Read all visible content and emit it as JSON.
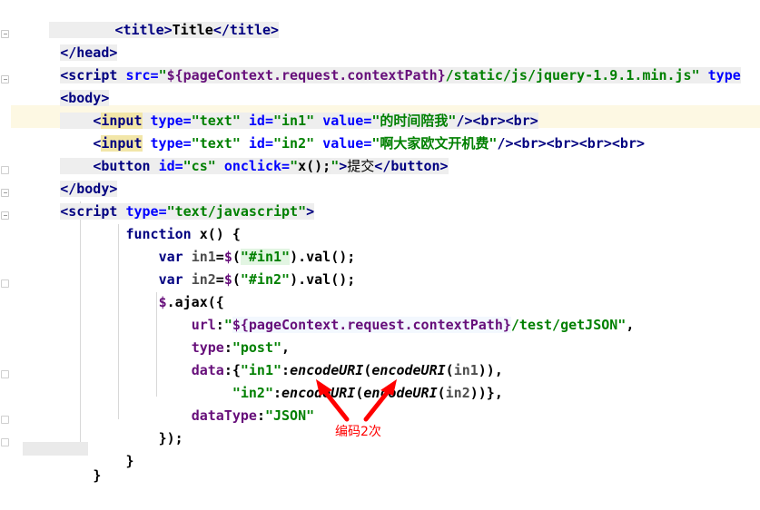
{
  "editor": {
    "language": "JSP / HTML",
    "font_size_px": 15,
    "line_height_px": 25,
    "background": "#ffffff"
  },
  "colors": {
    "tag": "#000080",
    "attribute": "#0000ff",
    "string": "#008000",
    "keyword": "#000080",
    "property": "#660e7a",
    "annotation_red": "#ff0000",
    "row_highlight_cream": "#fdf8e3",
    "token_highlight_yellow": "#f2e6a8",
    "token_highlight_gray": "#eeeeee",
    "token_highlight_green": "#e2f5e2",
    "token_highlight_blue": "#f3f8fe"
  },
  "lines": [
    {
      "n": 1,
      "text": "        <title>Title</title>"
    },
    {
      "n": 2,
      "text": "</head>"
    },
    {
      "n": 3,
      "text": "<script src=\"${pageContext.request.contextPath}/static/js/jquery-1.9.1.min.js\" type="
    },
    {
      "n": 4,
      "text": "<body>"
    },
    {
      "n": 5,
      "text": "    <input type=\"text\" id=\"in1\" value=\"的时间陪我\"/><br><br>"
    },
    {
      "n": 6,
      "text": "    <input type=\"text\" id=\"in2\" value=\"啊大家欧文开机费\"/><br><br><br><br>"
    },
    {
      "n": 7,
      "text": "    <button id=\"cs\" onclick=\"x();\">提交</button>"
    },
    {
      "n": 8,
      "text": "</body>"
    },
    {
      "n": 9,
      "text": "<script type=\"text/javascript\">"
    },
    {
      "n": 10,
      "text": "        function x() {"
    },
    {
      "n": 11,
      "text": "            var in1=$(\"#in1\").val();"
    },
    {
      "n": 12,
      "text": "            var in2=$(\"#in2\").val();"
    },
    {
      "n": 13,
      "text": "            $.ajax({"
    },
    {
      "n": 14,
      "text": "                url:\"${pageContext.request.contextPath}/test/getJSON\","
    },
    {
      "n": 15,
      "text": "                type:\"post\","
    },
    {
      "n": 16,
      "text": "                data:{\"in1\":encodeURI(encodeURI(in1)),"
    },
    {
      "n": 17,
      "text": "                     \"in2\":encodeURI(encodeURI(in2))},"
    },
    {
      "n": 18,
      "text": "                dataType:\"JSON\""
    },
    {
      "n": 19,
      "text": "            });"
    },
    {
      "n": 20,
      "text": "        }"
    },
    {
      "n": 21,
      "text": "    }"
    }
  ],
  "tokens": {
    "l1": {
      "indent": "        ",
      "open_lt": "<",
      "title_open": "title",
      "gt1": ">",
      "content": "Title",
      "close": "</title>"
    },
    "l2": {
      "text": "</head>"
    },
    "l3": {
      "tag_open": "<script",
      "attr_src": "src",
      "eq": "=",
      "quote": "\"",
      "el": "${pageContext.request.contextPath}",
      "path": "/static/js/jquery-1.9.1.min.js\"",
      "attr_type": "type"
    },
    "l4": {
      "text": "<body>"
    },
    "l5": {
      "lt": "<",
      "tagname": "input",
      "attr_type": "type",
      "val_text": "\"text\"",
      "attr_id": "id",
      "val_id": "\"in1\"",
      "attr_value": "value",
      "q1": "\"",
      "cjk": "的时间陪我",
      "q2": "\"",
      "tail": "/><br><br>"
    },
    "l6": {
      "lt": "<",
      "tagname": "input",
      "attr_type": "type",
      "val_text": "\"text\"",
      "attr_id": "id",
      "val_id": "\"in2\"",
      "attr_value": "value",
      "q1": "\"",
      "cjk": "啊大家欧文开机费",
      "q2": "\"",
      "tail": "/><br><br><br><br>"
    },
    "l7": {
      "lt": "<",
      "tagname": "button",
      "attr_id": "id",
      "val_id": "\"cs\"",
      "attr_onclick": "onclick",
      "q1": "\"",
      "js": "x();",
      "q2": "\"",
      "gt": ">",
      "cjk": "提交",
      "close": "</button>"
    },
    "l8": {
      "text": "</body>"
    },
    "l9": {
      "tag_open": "<script",
      "attr_type": "type",
      "eq": "=",
      "val": "\"text/javascript\"",
      "gt": ">"
    },
    "l10": {
      "kw": "function",
      "name": "x()",
      "brace": "{"
    },
    "l11": {
      "kw": "var",
      "name": "in1",
      "eq": "=",
      "dollar": "$",
      "lp": "(",
      "sel": "\"#in1\"",
      "rest": ").val();"
    },
    "l12": {
      "kw": "var",
      "name": "in2",
      "eq": "=",
      "dollar": "$",
      "lp": "(",
      "sel": "\"#in2\"",
      "rest": ").val();"
    },
    "l13": {
      "dollar": "$",
      "rest": ".ajax({"
    },
    "l14": {
      "key": "url",
      "colon": ":",
      "q": "\"",
      "el": "${pageContext.request.contextPath}",
      "path": "/test/getJSON\"",
      "comma": ","
    },
    "l15": {
      "key": "type",
      "colon": ":",
      "val": "\"post\"",
      "comma": ","
    },
    "l16": {
      "key": "data",
      "colon": ":",
      "brace": "{",
      "k1": "\"in1\"",
      "colon2": ":",
      "fn": "encodeURI",
      "lp": "(",
      "fn2": "encodeURI",
      "lp2": "(",
      "arg": "in1",
      "rest": ")),"
    },
    "l17": {
      "k2": "\"in2\"",
      "colon": ":",
      "fn": "encodeURI",
      "lp": "(",
      "fn2": "encodeURI",
      "lp2": "(",
      "arg": "in2",
      "rest": "))},"
    },
    "l18": {
      "key": "dataType",
      "colon": ":",
      "val": "\"JSON\""
    },
    "l19": {
      "text": "});"
    },
    "l20": {
      "text": "}"
    },
    "l21": {
      "text": "}"
    }
  },
  "annotations": [
    {
      "id": "encode-twice-note",
      "text": "编码2次",
      "color": "#ff0000",
      "arrows": 2,
      "arrow_description": "two red arrows pointing up-left and up-right toward the two encodeURI calls"
    }
  ]
}
